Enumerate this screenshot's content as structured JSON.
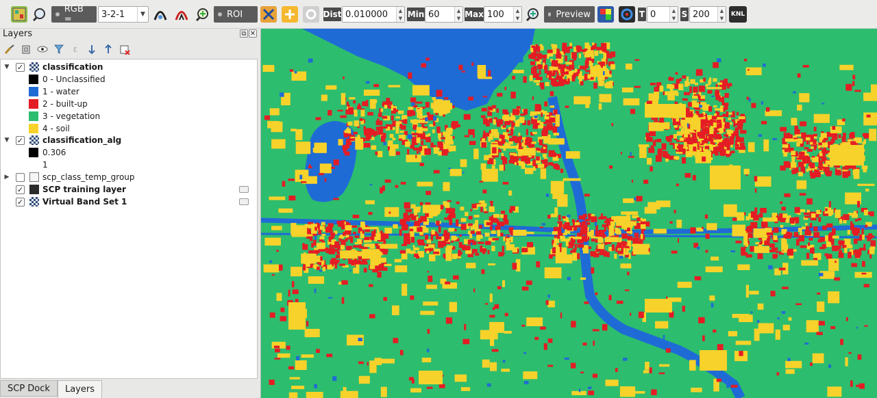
{
  "toolbar": {
    "rgb_label": "RGB =",
    "rgb_value": "3-2-1",
    "roi_label": "ROI",
    "dist_label": "Dist",
    "dist_value": "0.010000",
    "min_label": "Min",
    "min_value": "60",
    "max_label": "Max",
    "max_value": "100",
    "preview_label": "Preview",
    "t_label": "T",
    "t_value": "0",
    "s_label": "S",
    "s_value": "200",
    "knl_label": "KNL"
  },
  "panel": {
    "title": "Layers"
  },
  "layers": {
    "classification": {
      "name": "classification",
      "classes": [
        {
          "label": "0 - Unclassified",
          "color": "#000000"
        },
        {
          "label": "1 - water",
          "color": "#1f6bd6"
        },
        {
          "label": "2 - built-up",
          "color": "#e41c24"
        },
        {
          "label": "3 - vegetation",
          "color": "#2dbd6e"
        },
        {
          "label": "4 - soil",
          "color": "#f7d22a"
        }
      ]
    },
    "classification_alg": {
      "name": "classification_alg",
      "legend": [
        {
          "label": "0.306",
          "color": "#000000"
        },
        {
          "label": "1",
          "color": "#ffffff"
        }
      ]
    },
    "group": {
      "name": "scp_class_temp_group"
    },
    "training": {
      "name": "SCP training layer"
    },
    "bandset": {
      "name": "Virtual Band Set  1"
    }
  },
  "tabs": {
    "scp_dock": "SCP Dock",
    "layers": "Layers"
  },
  "map": {
    "water_color": "#1f6bd6",
    "builtup_color": "#e41c24",
    "vegetation_color": "#2dbd6e",
    "soil_color": "#f7d22a"
  }
}
